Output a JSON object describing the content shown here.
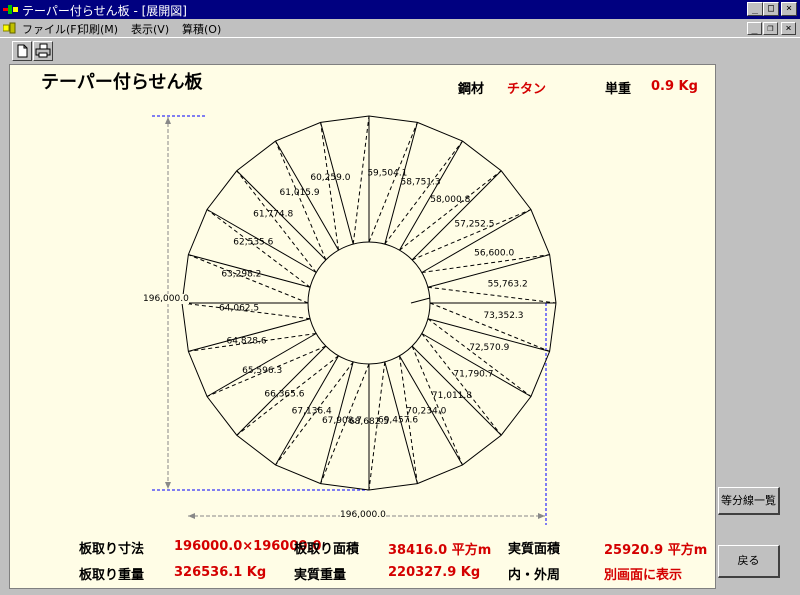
{
  "window": {
    "title": "テーパー付らせん板 - [展開図]",
    "minimize": "_",
    "maximize": "□",
    "close": "×",
    "child_minimize": "_",
    "child_restore": "❐",
    "child_close": "×"
  },
  "menu": {
    "file": "ファイル(F)",
    "print": "印刷(M)",
    "view": "表示(V)",
    "calc": "算積(O)"
  },
  "drawing": {
    "title": "テーパー付らせん板",
    "material_label": "鋼材",
    "material_value": "チタン",
    "unit_weight_label": "単重",
    "unit_weight_value": "0.9 Kg",
    "dim_vertical": "196,000.0",
    "dim_horizontal": "196,000.0",
    "segment_labels": [
      "59,504.1",
      "58,751.3",
      "58,000.8",
      "57,252.5",
      "56,600.0",
      "55,763.2",
      "73,352.3",
      "72,570.9",
      "71,790.7",
      "71,011.8",
      "70,234.0",
      "69,457.6",
      "68,682.5",
      "67,908.7",
      "67,136.4",
      "66,365.6",
      "65,596.3",
      "64,828.6",
      "64,062.5",
      "63,298.2",
      "62,535.6",
      "61,774.8",
      "61,015.9",
      "60,259.0"
    ]
  },
  "summary": {
    "board_size_label": "板取り寸法",
    "board_size_value": "196000.0×196000.0",
    "board_area_label": "板取り面積",
    "board_area_value": "38416.0 平方m",
    "actual_area_label": "実質面積",
    "actual_area_value": "25920.9 平方m",
    "board_weight_label": "板取り重量",
    "board_weight_value": "326536.1 Kg",
    "actual_weight_label": "実質重量",
    "actual_weight_value": "220327.9 Kg",
    "inner_outer_label": "内・外周",
    "inner_outer_value": "別画面に表示"
  },
  "buttons": {
    "division_list": "等分線一覧",
    "back": "戻る"
  },
  "colors": {
    "titlebar": "#000080",
    "canvas": "#fffde6",
    "value_red": "#d40000",
    "dim_blue": "#0000ff"
  }
}
